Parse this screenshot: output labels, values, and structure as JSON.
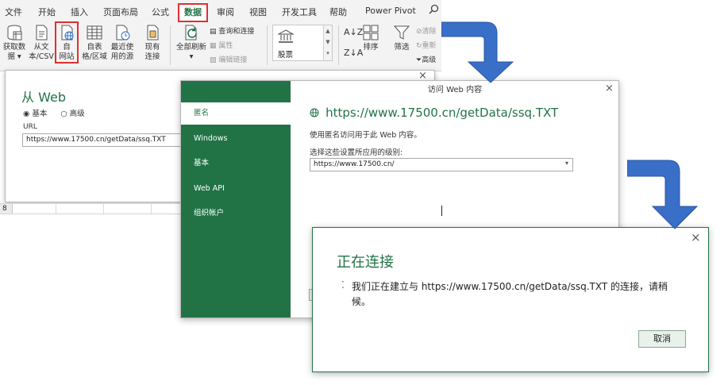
{
  "ribbon": {
    "tabs": [
      "文件",
      "开始",
      "插入",
      "页面布局",
      "公式",
      "数据",
      "审阅",
      "视图",
      "开发工具",
      "帮助",
      "Power Pivot"
    ],
    "active_tab": "数据",
    "buttons": {
      "get_data": "获取数\n据 ▾",
      "from_text_csv": "从文\n本/CSV",
      "from_web": "自\n网站",
      "from_table": "自表\n格/区域",
      "recent_sources": "最近使\n用的源",
      "existing_connections": "现有\n连接",
      "refresh_all": "全部刷新\n▾",
      "stocks": "股票",
      "sort": "排序",
      "filter": "筛选"
    },
    "connections_group": {
      "queries_connections": "查询和连接",
      "properties": "属性",
      "edit_links": "编辑链接"
    },
    "filter_group": {
      "clear": "清除",
      "reapply": "重新",
      "advanced": "高级"
    },
    "highlight_color": "#e03030"
  },
  "from_web_dialog": {
    "title": "从 Web",
    "mode_basic": "基本",
    "mode_advanced": "高级",
    "selected_mode": "basic",
    "url_label": "URL",
    "url_value": "https://www.17500.cn/getData/ssq.TXT",
    "close": "×"
  },
  "sheet": {
    "row_number": "8"
  },
  "access_dialog": {
    "header": "访问 Web 内容",
    "close": "×",
    "sidebar": [
      "匿名",
      "Windows",
      "基本",
      "Web API",
      "组织帐户"
    ],
    "selected_index": 0,
    "url_title": "https://www.17500.cn/getData/ssq.TXT",
    "description": "使用匿名访问用于此 Web 内容。",
    "level_label": "选择这些设置所应用的级别:",
    "level_value": "https://www.17500.cn/",
    "accent": "#217346"
  },
  "connecting_dialog": {
    "title": "正在连接",
    "message": "我们正在建立与 https://www.17500.cn/getData/ssq.TXT 的连接，请稍候。",
    "cancel": "取消",
    "close": "×"
  },
  "arrow_color": "#3a6fc8"
}
